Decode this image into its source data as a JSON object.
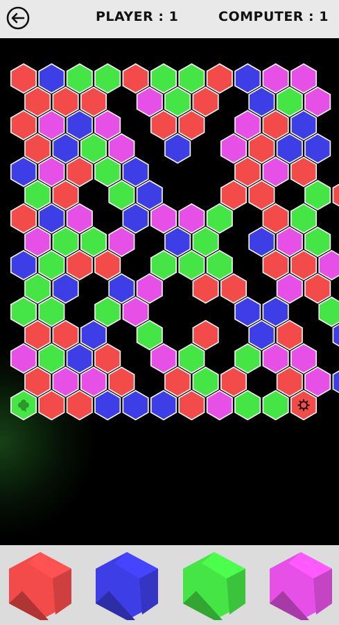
{
  "header": {
    "player_label": "PLAYER : 1",
    "computer_label": "COMPUTER : 1"
  },
  "palette": {
    "red": "#f34a4a",
    "blue": "#3e3ee6",
    "green": "#45e545",
    "pink": "#e650e6"
  },
  "board": {
    "player_marker": "clover-icon",
    "computer_marker": "gear-icon",
    "rows": [
      "RBGGRGGRBPP",
      "RRR.PGR.BGP",
      "RPBP.RR.PRB",
      "RBGP.B.PRBB",
      "BPRGB...RPR",
      "GR.GB..RR.GR",
      "RBP.BPPG.RG",
      "PGGP.BG.BPG",
      "BGRR.GGG.RRP",
      "GB.BP.RR.PR",
      "GG.GP...BB.G",
      "RRB.G.R.BR.BR",
      "PGBR.PG.GPP",
      "RPPR.RGR.RPB",
      "GRRBBBRPGGR"
    ]
  },
  "controls": {
    "buttons": [
      "red",
      "blue",
      "green",
      "pink"
    ]
  }
}
